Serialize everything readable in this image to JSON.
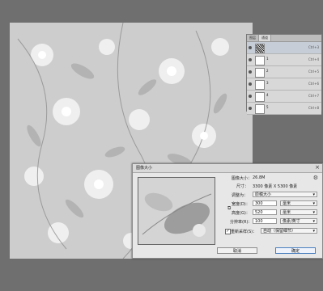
{
  "layers_panel": {
    "tabs": [
      "图层",
      "通道"
    ],
    "layers": [
      {
        "name": "",
        "shortcut": "Ctrl+3",
        "selected": true,
        "dark": true
      },
      {
        "name": "1",
        "shortcut": "Ctrl+4",
        "selected": false,
        "dark": false
      },
      {
        "name": "2",
        "shortcut": "Ctrl+5",
        "selected": false,
        "dark": false
      },
      {
        "name": "3",
        "shortcut": "Ctrl+6",
        "selected": false,
        "dark": false
      },
      {
        "name": "4",
        "shortcut": "Ctrl+7",
        "selected": false,
        "dark": false
      },
      {
        "name": "5",
        "shortcut": "Ctrl+8",
        "selected": false,
        "dark": false
      }
    ]
  },
  "dialog": {
    "title": "图像大小",
    "image_size_label": "图像大小：",
    "image_size_value": "26.8M",
    "dimensions_label": "尺寸：",
    "dimensions_value": "3300 像素 X 5300 像素",
    "fit_label": "调整为：",
    "fit_value": "原稿大小",
    "width_label": "宽度(D)：",
    "width_value": "300",
    "width_unit": "毫米",
    "height_label": "高度(G)：",
    "height_value": "520",
    "height_unit": "毫米",
    "resolution_label": "分辨率(R)：",
    "resolution_value": "100",
    "resolution_unit": "像素/英寸",
    "resample_label": "重新采样(S)：",
    "resample_value": "自动（保留细节）",
    "resample_checked": true,
    "cancel_label": "取消",
    "ok_label": "确定"
  },
  "icons": {
    "gear": "gear-icon",
    "link": "link-icon",
    "close": "close-icon",
    "eye": "eye-icon"
  }
}
